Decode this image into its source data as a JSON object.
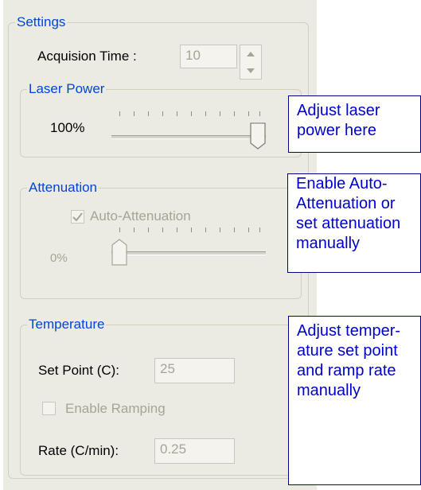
{
  "settings": {
    "legend": "Settings",
    "acquisition_label": "Acquision Time :",
    "acquisition_value": "10"
  },
  "laser_power": {
    "legend": "Laser Power",
    "value_label": "100%",
    "level_percent": 100
  },
  "attenuation": {
    "legend": "Attenuation",
    "auto_label": "Auto-Attenuation",
    "auto_checked": true,
    "value_label": "0%",
    "level_percent": 0
  },
  "temperature": {
    "legend": "Temperature",
    "setpoint_label": "Set Point (C):",
    "setpoint_value": "25",
    "ramping_label": "Enable Ramping",
    "ramping_checked": false,
    "rate_label": "Rate (C/min):",
    "rate_value": "0.25"
  },
  "callouts": {
    "laser": "Adjust laser\npower here",
    "attenuation": "Enable Auto-\nAttenuation or\nset attenuation\nmanually",
    "temperature": "Adjust temper-\nature set point\nand ramp rate\nmanually"
  },
  "colors": {
    "panel_bg": "#ecebe3",
    "group_legend": "#0046d5",
    "disabled_text": "#a5a594",
    "callout_text": "#0000cc",
    "callout_border": "#000080"
  },
  "icons": [
    "spin-up-icon",
    "spin-down-icon",
    "slider-thumb-icon",
    "checkmark-icon"
  ]
}
